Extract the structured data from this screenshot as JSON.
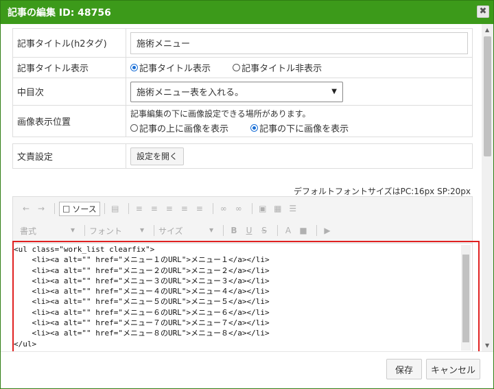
{
  "dialog": {
    "title": "記事の編集 ID: 48756",
    "close_label": "✖"
  },
  "form": {
    "title_row": {
      "label": "記事タイトル(h2タグ)",
      "value": "施術メニュー"
    },
    "title_display": {
      "label": "記事タイトル表示",
      "options": [
        "記事タイトル表示",
        "記事タイトル非表示"
      ],
      "selected": 0
    },
    "toc": {
      "label": "中目次",
      "selected": "施術メニュー表を入れる。"
    },
    "image_position": {
      "label": "画像表示位置",
      "note": "記事編集の下に画像設定できる場所があります。",
      "options": [
        "記事の上に画像を表示",
        "記事の下に画像を表示"
      ],
      "selected": 1
    },
    "liability": {
      "label": "文責設定",
      "button": "設定を開く"
    }
  },
  "editor": {
    "font_hint": "デフォルトフォントサイズはPC:16px SP:20px",
    "source_button": "ソース",
    "combo_format": "書式",
    "combo_font": "フォント",
    "combo_size": "サイズ",
    "code": "<ul class=\"work_list clearfix\">\n    <li><a alt=\"\" href=\"メニュー１のURL\">メニュー１</a></li>\n    <li><a alt=\"\" href=\"メニュー２のURL\">メニュー２</a></li>\n    <li><a alt=\"\" href=\"メニュー３のURL\">メニュー３</a></li>\n    <li><a alt=\"\" href=\"メニュー４のURL\">メニュー４</a></li>\n    <li><a alt=\"\" href=\"メニュー５のURL\">メニュー５</a></li>\n    <li><a alt=\"\" href=\"メニュー６のURL\">メニュー６</a></li>\n    <li><a alt=\"\" href=\"メニュー７のURL\">メニュー７</a></li>\n    <li><a alt=\"\" href=\"メニュー８のURL\">メニュー８</a></li>\n</ul>\n<style type=\"text/css\">.work_list {"
  },
  "footer": {
    "save": "保存",
    "cancel": "キャンセル"
  },
  "colors": {
    "titlebar": "#3c9a1a",
    "highlight": "#e02020",
    "radio_on": "#1a6fd6"
  }
}
